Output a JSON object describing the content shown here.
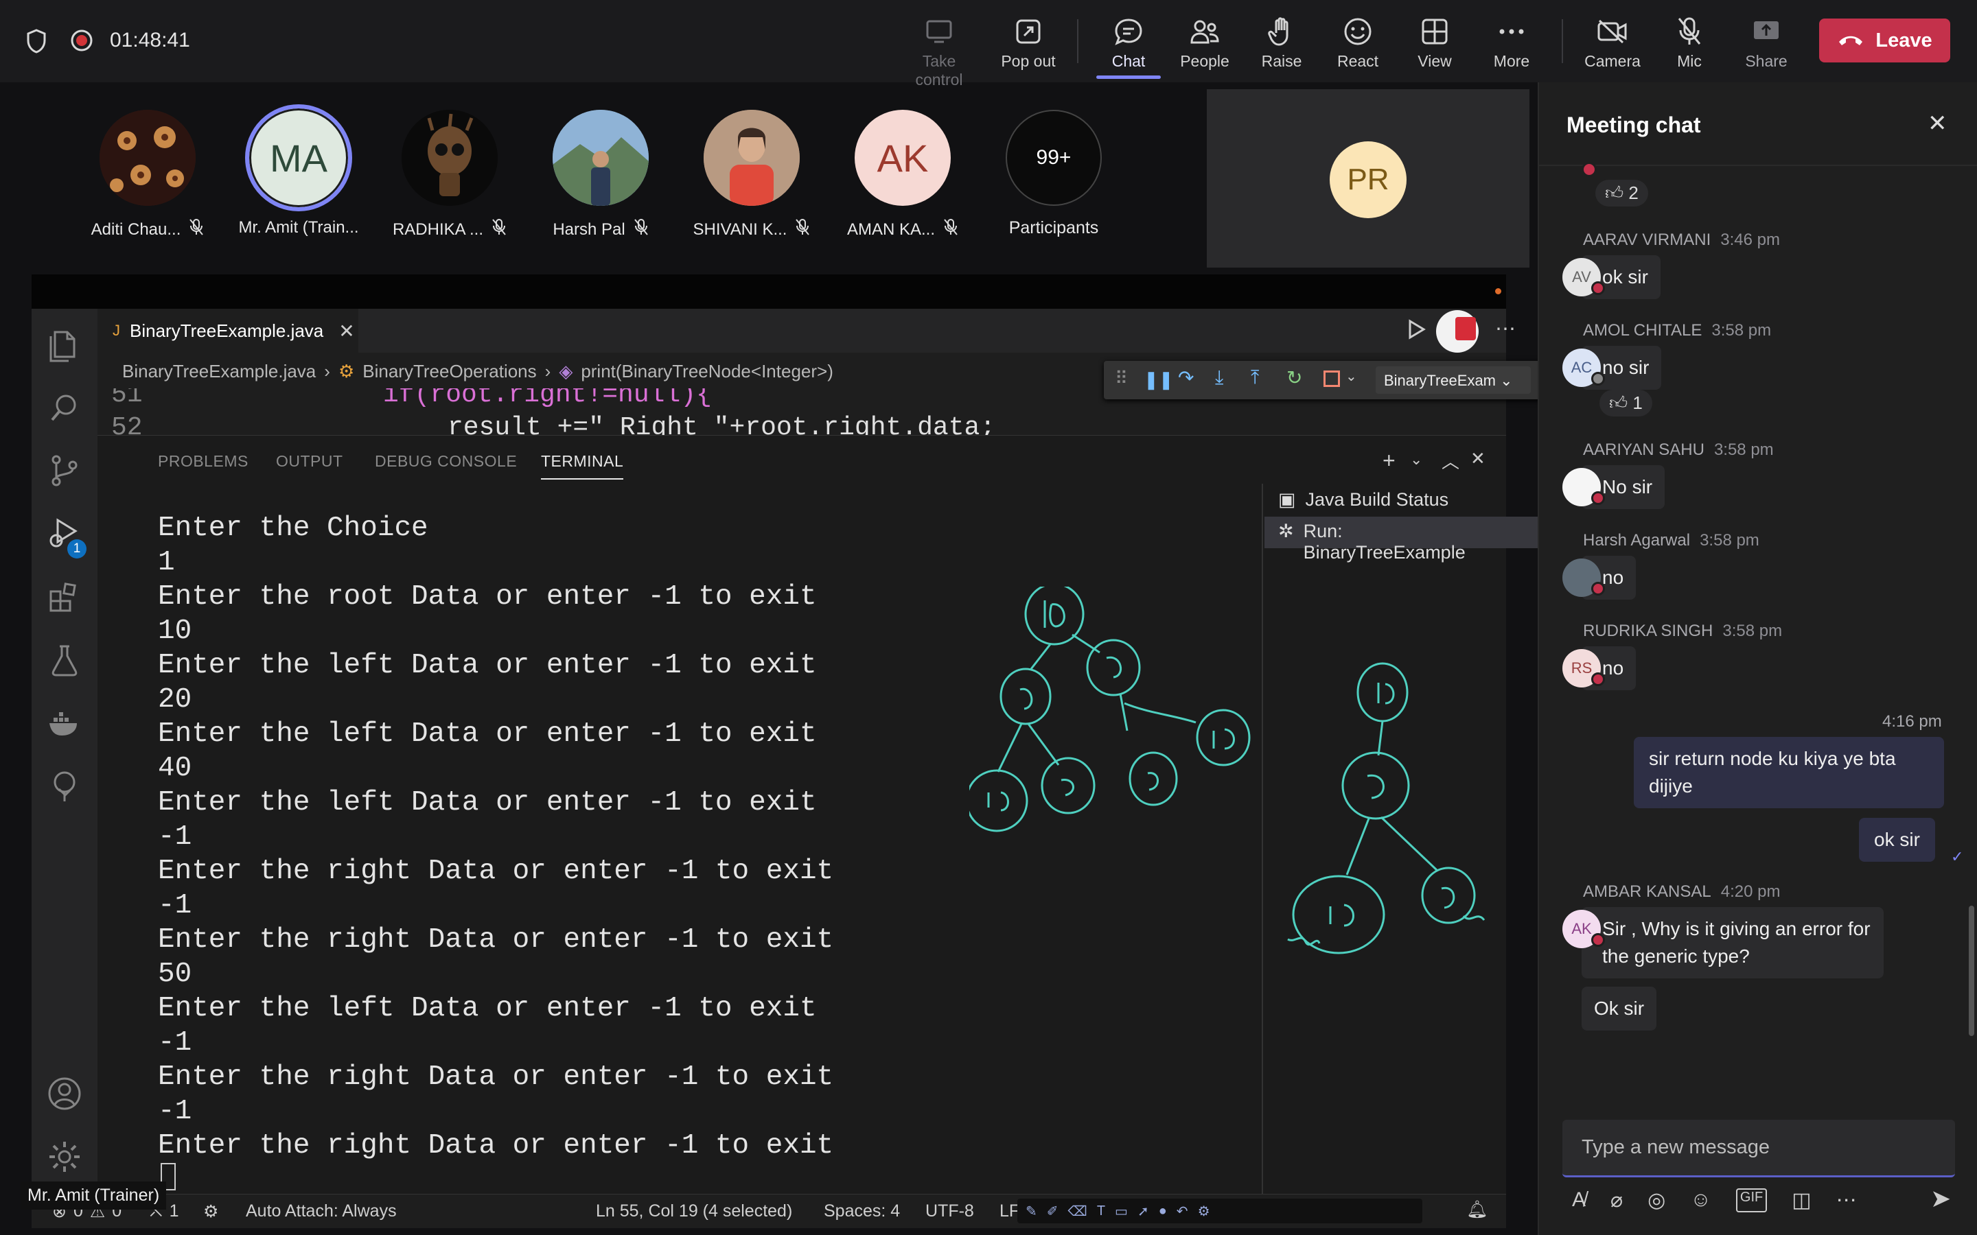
{
  "topbar": {
    "timer": "01:48:41",
    "buttons": {
      "take_control": "Take control",
      "pop_out": "Pop out",
      "chat": "Chat",
      "people": "People",
      "raise": "Raise",
      "react": "React",
      "view": "View",
      "more": "More",
      "camera": "Camera",
      "mic": "Mic",
      "share": "Share",
      "leave": "Leave"
    }
  },
  "participants": [
    {
      "name": "Aditi Chau...",
      "initials": ""
    },
    {
      "name": "Mr. Amit (Train...",
      "initials": "MA"
    },
    {
      "name": "RADHIKA ...",
      "initials": ""
    },
    {
      "name": "Harsh Pal",
      "initials": ""
    },
    {
      "name": "SHIVANI K...",
      "initials": ""
    },
    {
      "name": "AMAN KA...",
      "initials": "AK"
    }
  ],
  "overflow": {
    "count": "99+",
    "label": "Participants"
  },
  "self_tile": {
    "initials": "PR"
  },
  "vscode": {
    "tab_file": "BinaryTreeExample.java",
    "breadcrumb": [
      "BinaryTreeExample.java",
      "BinaryTreeOperations",
      "print(BinaryTreeNode<Integer>)"
    ],
    "debug_target": "BinaryTreeExam",
    "debug_badge": "1",
    "code_lines": [
      {
        "num": "51",
        "text": "if(root.right!=null){"
      },
      {
        "num": "52",
        "text": "result +=\" Right \"+root.right.data;"
      }
    ],
    "panel_tabs": [
      "PROBLEMS",
      "OUTPUT",
      "DEBUG CONSOLE",
      "TERMINAL"
    ],
    "terminal_list": [
      "Java Build Status",
      "Run: BinaryTreeExample"
    ],
    "terminal_lines": [
      "Enter the Choice",
      "1",
      "Enter the root Data or enter -1 to exit",
      "10",
      "Enter the left Data or enter -1 to exit",
      "20",
      "Enter the left Data or enter -1 to exit",
      "40",
      "Enter the left Data or enter -1 to exit",
      "-1",
      "Enter the right Data or enter -1 to exit",
      "-1",
      "Enter the right Data or enter -1 to exit",
      "50",
      "Enter the left Data or enter -1 to exit",
      "-1",
      "Enter the right Data or enter -1 to exit",
      "-1",
      "Enter the right Data or enter -1 to exit"
    ],
    "status": {
      "errors": "0",
      "warnings": "0",
      "ports": "1",
      "auto_attach": "Auto Attach: Always",
      "cursor": "Ln 55, Col 19 (4 selected)",
      "spaces": "Spaces: 4",
      "encoding": "UTF-8",
      "eol": "LF"
    },
    "presenter_label": "Mr. Amit (Trainer)"
  },
  "chat": {
    "title": "Meeting chat",
    "top_reaction": "2",
    "messages": [
      {
        "sender": "AARAV VIRMANI",
        "time": "3:46 pm",
        "initials": "AV",
        "text": "ok sir"
      },
      {
        "sender": "AMOL CHITALE",
        "time": "3:58 pm",
        "initials": "AC",
        "text": "no sir",
        "reaction": "1"
      },
      {
        "sender": "AARIYAN SAHU",
        "time": "3:58 pm",
        "initials": "",
        "text": "No sir"
      },
      {
        "sender": "Harsh Agarwal",
        "time": "3:58 pm",
        "initials": "",
        "text": "no"
      },
      {
        "sender": "RUDRIKA SINGH",
        "time": "3:58 pm",
        "initials": "RS",
        "text": "no"
      }
    ],
    "mine_time": "4:16 pm",
    "mine": [
      "sir return node ku kiya ye bta dijiye",
      "ok sir"
    ],
    "last": {
      "sender": "AMBAR KANSAL",
      "time": "4:20 pm",
      "initials": "AK",
      "texts": [
        "Sir , Why is it giving an error for the generic type?",
        "Ok sir"
      ]
    },
    "composer_placeholder": "Type a new message"
  }
}
